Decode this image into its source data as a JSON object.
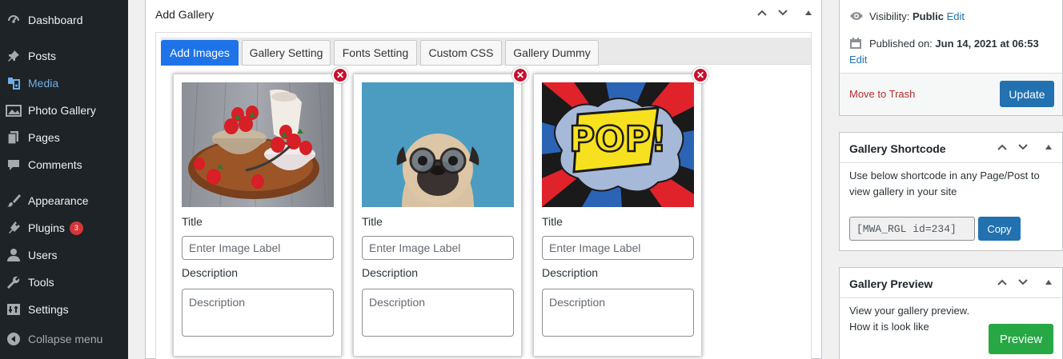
{
  "sidebar": {
    "items": [
      {
        "label": "Dashboard",
        "icon": "dashboard-icon"
      },
      {
        "label": "Posts",
        "icon": "pin-icon"
      },
      {
        "label": "Media",
        "icon": "media-icon"
      },
      {
        "label": "Photo Gallery",
        "icon": "photo-gallery-icon"
      },
      {
        "label": "Pages",
        "icon": "pages-icon"
      },
      {
        "label": "Comments",
        "icon": "comment-icon"
      },
      {
        "label": "Appearance",
        "icon": "paintbrush-icon"
      },
      {
        "label": "Plugins",
        "icon": "plugin-icon",
        "badge": "3"
      },
      {
        "label": "Users",
        "icon": "users-icon"
      },
      {
        "label": "Tools",
        "icon": "wrench-icon"
      },
      {
        "label": "Settings",
        "icon": "settings-icon"
      },
      {
        "label": "Collapse menu",
        "icon": "collapse-icon"
      }
    ]
  },
  "gallery": {
    "title": "Add Gallery",
    "tabs": [
      "Add Images",
      "Gallery Setting",
      "Fonts Setting",
      "Custom CSS",
      "Gallery Dummy"
    ],
    "images": [
      {
        "name": "strawberries-image",
        "title_label": "Title",
        "title_placeholder": "Enter Image Label",
        "desc_label": "Description",
        "desc_placeholder": "Description"
      },
      {
        "name": "pug-glasses-image",
        "title_label": "Title",
        "title_placeholder": "Enter Image Label",
        "desc_label": "Description",
        "desc_placeholder": "Description"
      },
      {
        "name": "pop-art-image",
        "title_label": "Title",
        "title_placeholder": "Enter Image Label",
        "desc_label": "Description",
        "desc_placeholder": "Description",
        "pop_text": "POP!"
      }
    ],
    "remove_symbol": "✕"
  },
  "publish": {
    "visibility_label": "Visibility:",
    "visibility_value": "Public",
    "visibility_edit": "Edit",
    "published_label": "Published on:",
    "published_value": "Jun 14, 2021 at 06:53",
    "published_edit": "Edit",
    "trash": "Move to Trash",
    "update": "Update"
  },
  "shortcode": {
    "title": "Gallery Shortcode",
    "text": "Use below shortcode in any Page/Post to view gallery in your site",
    "value": "[MWA_RGL id=234]",
    "copy": "Copy"
  },
  "preview": {
    "title": "Gallery Preview",
    "text": "View your gallery preview. How it is look like",
    "button": "Preview"
  },
  "colors": {
    "sidebar_bg": "#1d2327",
    "active_menu": "#72aee6",
    "tab_active": "#1e73e8",
    "wp_blue": "#2271b1",
    "preview_green": "#28a745",
    "trash_red": "#b32d2e"
  }
}
